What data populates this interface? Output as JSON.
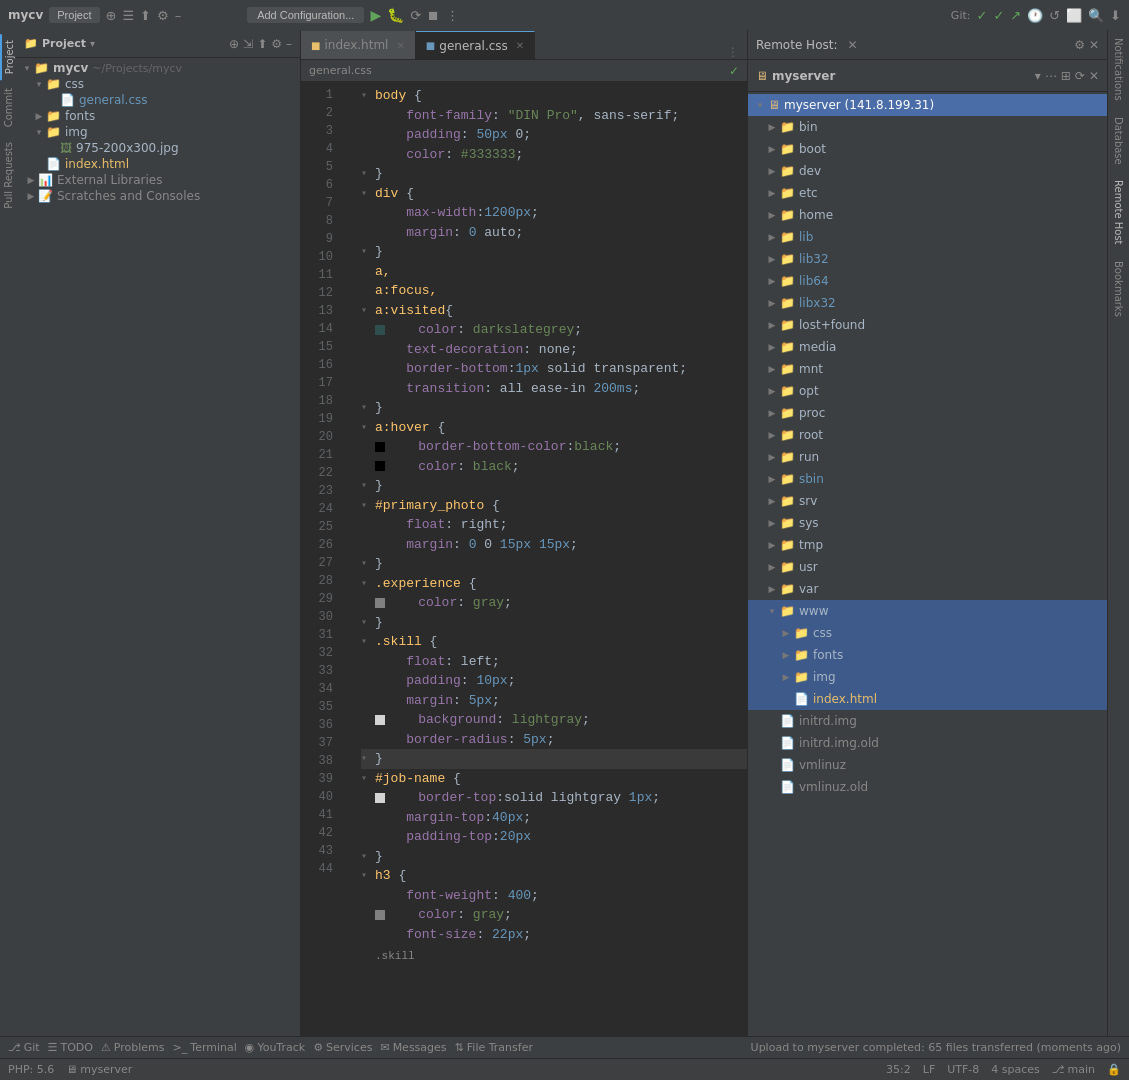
{
  "titleBar": {
    "appName": "mycv",
    "projectBtn": "Project",
    "configBtn": "Add Configuration...",
    "gitLabel": "Git:",
    "minBtn": "–",
    "maxBtn": "□",
    "searchIcon": "🔍"
  },
  "sidebar": {
    "header": "Project",
    "rootLabel": "mycv",
    "rootPath": "~/Projects/mycv",
    "items": [
      {
        "indent": 0,
        "type": "folder",
        "label": "css",
        "open": true
      },
      {
        "indent": 1,
        "type": "file-css",
        "label": "general.css"
      },
      {
        "indent": 0,
        "type": "folder",
        "label": "fonts",
        "open": false
      },
      {
        "indent": 0,
        "type": "folder",
        "label": "img",
        "open": true
      },
      {
        "indent": 1,
        "type": "file-img",
        "label": "975-200x300.jpg"
      },
      {
        "indent": 0,
        "type": "file-html",
        "label": "index.html"
      },
      {
        "indent": 0,
        "type": "external",
        "label": "External Libraries"
      },
      {
        "indent": 0,
        "type": "scratches",
        "label": "Scratches and Consoles"
      }
    ]
  },
  "tabs": [
    {
      "label": "index.html",
      "type": "html",
      "active": false
    },
    {
      "label": "general.css",
      "type": "css",
      "active": true
    }
  ],
  "editor": {
    "breadcrumb": "general.css",
    "lines": [
      {
        "num": 1,
        "fold": "▾",
        "code": "body {"
      },
      {
        "num": 2,
        "fold": " ",
        "code": "    font-family: \"DIN Pro\", sans-serif;"
      },
      {
        "num": 3,
        "fold": " ",
        "code": "    padding: 50px 0;"
      },
      {
        "num": 4,
        "fold": " ",
        "code": "    color: #333333;"
      },
      {
        "num": 5,
        "fold": "▾",
        "code": "}"
      },
      {
        "num": 6,
        "fold": "▾",
        "code": "div {"
      },
      {
        "num": 7,
        "fold": " ",
        "code": "    max-width:1200px;"
      },
      {
        "num": 8,
        "fold": " ",
        "code": "    margin: 0 auto;"
      },
      {
        "num": 9,
        "fold": "▾",
        "code": "}"
      },
      {
        "num": 10,
        "fold": " ",
        "code": "a,"
      },
      {
        "num": 11,
        "fold": " ",
        "code": "a:focus,"
      },
      {
        "num": 12,
        "fold": "▾",
        "code": "a:visited{"
      },
      {
        "num": 13,
        "fold": " ",
        "code": "    color: darkslategrey;",
        "swatch": "#2f4f4f"
      },
      {
        "num": 14,
        "fold": " ",
        "code": "    text-decoration: none;"
      },
      {
        "num": 15,
        "fold": " ",
        "code": "    border-bottom:1px solid transparent;"
      },
      {
        "num": 16,
        "fold": " ",
        "code": "    transition: all ease-in 200ms;"
      },
      {
        "num": 17,
        "fold": "▾",
        "code": "}"
      },
      {
        "num": 18,
        "fold": "▾",
        "code": "a:hover {"
      },
      {
        "num": 19,
        "fold": " ",
        "code": "    border-bottom-color:black;",
        "swatch": "#000000"
      },
      {
        "num": 20,
        "fold": " ",
        "code": "    color: black;",
        "swatch": "#000000"
      },
      {
        "num": 21,
        "fold": "▾",
        "code": "}"
      },
      {
        "num": 22,
        "fold": "▾",
        "code": "#primary_photo {"
      },
      {
        "num": 23,
        "fold": " ",
        "code": "    float: right;"
      },
      {
        "num": 24,
        "fold": " ",
        "code": "    margin: 0 0 15px 15px;"
      },
      {
        "num": 25,
        "fold": "▾",
        "code": "}"
      },
      {
        "num": 26,
        "fold": "▾",
        "code": ".experience {"
      },
      {
        "num": 27,
        "fold": " ",
        "code": "    color: gray;",
        "swatch": "#808080"
      },
      {
        "num": 28,
        "fold": "▾",
        "code": "}"
      },
      {
        "num": 29,
        "fold": "▾",
        "code": ".skill {"
      },
      {
        "num": 30,
        "fold": " ",
        "code": "    float: left;"
      },
      {
        "num": 31,
        "fold": " ",
        "code": "    padding: 10px;"
      },
      {
        "num": 32,
        "fold": " ",
        "code": "    margin: 5px;"
      },
      {
        "num": 33,
        "fold": " ",
        "code": "    background: lightgray;",
        "swatch": "#d3d3d3"
      },
      {
        "num": 34,
        "fold": " ",
        "code": "    border-radius: 5px;"
      },
      {
        "num": 35,
        "fold": "▾",
        "code": "}"
      },
      {
        "num": 36,
        "fold": "▾",
        "code": "#job-name {"
      },
      {
        "num": 37,
        "fold": " ",
        "code": "    border-top:solid lightgray 1px;",
        "swatch": "#d3d3d3"
      },
      {
        "num": 38,
        "fold": " ",
        "code": "    margin-top:40px;"
      },
      {
        "num": 39,
        "fold": " ",
        "code": "    padding-top:20px"
      },
      {
        "num": 40,
        "fold": "▾",
        "code": "}"
      },
      {
        "num": 41,
        "fold": "▾",
        "code": "h3 {"
      },
      {
        "num": 42,
        "fold": " ",
        "code": "    font-weight: 400;"
      },
      {
        "num": 43,
        "fold": " ",
        "code": "    color: gray;",
        "swatch": "#808080"
      },
      {
        "num": 44,
        "fold": " ",
        "code": "    font-size: 22px;"
      }
    ]
  },
  "remote": {
    "headerTitle": "Remote Host:",
    "serverName": "myserver",
    "serverIp": "(141.8.199.31)",
    "tree": [
      {
        "indent": 0,
        "label": "myserver (141.8.199.31)",
        "type": "server",
        "selected": true
      },
      {
        "indent": 1,
        "label": "bin",
        "type": "folder",
        "open": false
      },
      {
        "indent": 1,
        "label": "boot",
        "type": "folder",
        "open": false
      },
      {
        "indent": 1,
        "label": "dev",
        "type": "folder",
        "open": false
      },
      {
        "indent": 1,
        "label": "etc",
        "type": "folder",
        "open": false
      },
      {
        "indent": 1,
        "label": "home",
        "type": "folder",
        "open": false
      },
      {
        "indent": 1,
        "label": "lib",
        "type": "folder",
        "open": false
      },
      {
        "indent": 1,
        "label": "lib32",
        "type": "folder",
        "open": false
      },
      {
        "indent": 1,
        "label": "lib64",
        "type": "folder",
        "open": false
      },
      {
        "indent": 1,
        "label": "libx32",
        "type": "folder",
        "open": false
      },
      {
        "indent": 1,
        "label": "lost+found",
        "type": "folder",
        "open": false
      },
      {
        "indent": 1,
        "label": "media",
        "type": "folder",
        "open": false
      },
      {
        "indent": 1,
        "label": "mnt",
        "type": "folder",
        "open": false
      },
      {
        "indent": 1,
        "label": "opt",
        "type": "folder",
        "open": false
      },
      {
        "indent": 1,
        "label": "proc",
        "type": "folder",
        "open": false
      },
      {
        "indent": 1,
        "label": "root",
        "type": "folder",
        "open": false
      },
      {
        "indent": 1,
        "label": "run",
        "type": "folder",
        "open": false
      },
      {
        "indent": 1,
        "label": "sbin",
        "type": "folder",
        "open": false
      },
      {
        "indent": 1,
        "label": "srv",
        "type": "folder",
        "open": false
      },
      {
        "indent": 1,
        "label": "sys",
        "type": "folder",
        "open": false
      },
      {
        "indent": 1,
        "label": "tmp",
        "type": "folder",
        "open": false
      },
      {
        "indent": 1,
        "label": "usr",
        "type": "folder",
        "open": false
      },
      {
        "indent": 1,
        "label": "var",
        "type": "folder",
        "open": false
      },
      {
        "indent": 1,
        "label": "www",
        "type": "folder",
        "open": true,
        "highlighted": true
      },
      {
        "indent": 2,
        "label": "css",
        "type": "folder",
        "open": false
      },
      {
        "indent": 2,
        "label": "fonts",
        "type": "folder",
        "open": false
      },
      {
        "indent": 2,
        "label": "img",
        "type": "folder",
        "open": false
      },
      {
        "indent": 2,
        "label": "index.html",
        "type": "file-html"
      },
      {
        "indent": 1,
        "label": "initrd.img",
        "type": "file"
      },
      {
        "indent": 1,
        "label": "initrd.img.old",
        "type": "file"
      },
      {
        "indent": 1,
        "label": "vmlinuz",
        "type": "file"
      },
      {
        "indent": 1,
        "label": "vmlinuz.old",
        "type": "file"
      }
    ]
  },
  "bottomTabs": [
    {
      "label": "Git",
      "icon": "⎇"
    },
    {
      "label": "TODO",
      "icon": "☰"
    },
    {
      "label": "Problems",
      "icon": "⚠"
    },
    {
      "label": "Terminal",
      "icon": ">_"
    },
    {
      "label": "YouTrack",
      "icon": "◉"
    },
    {
      "label": "Services",
      "icon": "⚙"
    },
    {
      "label": "Messages",
      "icon": "✉"
    },
    {
      "label": "File Transfer",
      "icon": "⇅"
    }
  ],
  "statusBar": {
    "php": "PHP: 5.6",
    "server": "myserver",
    "position": "35:2",
    "lineEnding": "LF",
    "encoding": "UTF-8",
    "indent": "4 spaces",
    "branch": "main"
  },
  "uploadMsg": "Upload to myserver completed: 65 files transferred (moments ago)"
}
